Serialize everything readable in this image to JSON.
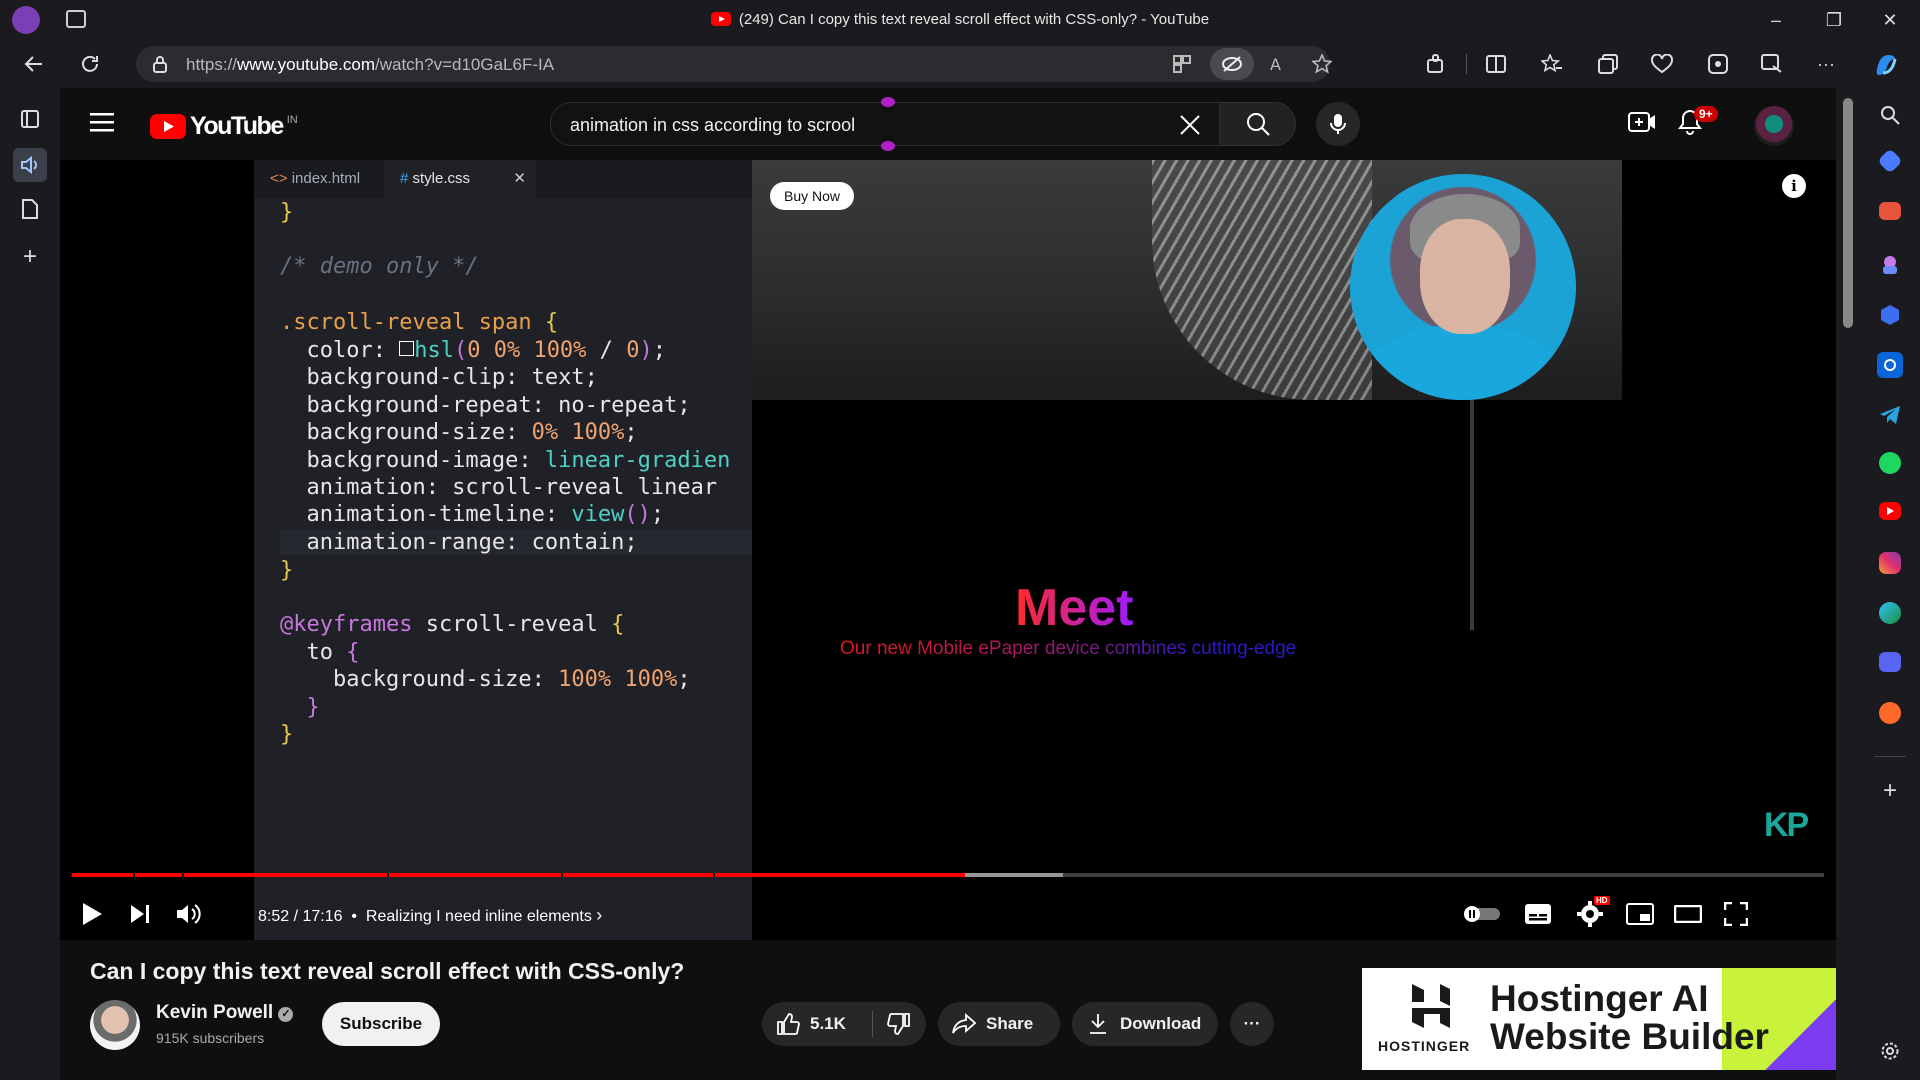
{
  "browser": {
    "window_title": "(249) Can I copy this text reveal scroll effect with CSS-only? - YouTube",
    "url_prefix": "https://",
    "url_domain": "www.youtube.com",
    "url_path": "/watch?v=d10GaL6F-IA",
    "controls": {
      "minimize": "–",
      "restore": "❐",
      "close": "✕"
    }
  },
  "youtube": {
    "logo_text": "YouTube",
    "region_badge": "IN",
    "search_query": "animation in css according to scrool",
    "notifications_count": "9+"
  },
  "video": {
    "editor_tabs": [
      {
        "label": "index.html",
        "icon": "<>"
      },
      {
        "label": "style.css",
        "icon": "#"
      }
    ],
    "code_lines": [
      "}",
      "",
      "/* demo only */",
      "",
      ".scroll-reveal span {",
      "  color: hsl(0 0% 100% / 0);",
      "  background-clip: text;",
      "  background-repeat: no-repeat;",
      "  background-size: 0% 100%;",
      "  background-image: linear-gradien",
      "  animation: scroll-reveal linear",
      "  animation-timeline: view();",
      "  animation-range: contain;",
      "}",
      "",
      "@keyframes scroll-reveal {",
      "  to {",
      "    background-size: 100% 100%;",
      "  }",
      "}"
    ],
    "buy_now": "Buy Now",
    "demo_heading": "Meet",
    "demo_tagline": "Our new Mobile ePaper device combines cutting-edge",
    "watermark": "KP",
    "progress_played": 0.5099,
    "progress_loaded": 0.5659,
    "time": "8:52 / 17:16",
    "chapter": "Realizing I need inline elements",
    "info": "i"
  },
  "details": {
    "title": "Can I copy this text reveal scroll effect with CSS-only?",
    "channel": "Kevin Powell",
    "subscribers": "915K subscribers",
    "subscribe": "Subscribe",
    "likes": "5.1K",
    "share": "Share",
    "download": "Download",
    "more": "···"
  },
  "ad": {
    "brand": "HOSTINGER",
    "headline_line1": "Hostinger AI",
    "headline_line2": "Website Builder"
  },
  "colors": {
    "accent": "#ff0000",
    "background": "#0f0f0f",
    "browser_chrome": "#1b1b1f"
  }
}
